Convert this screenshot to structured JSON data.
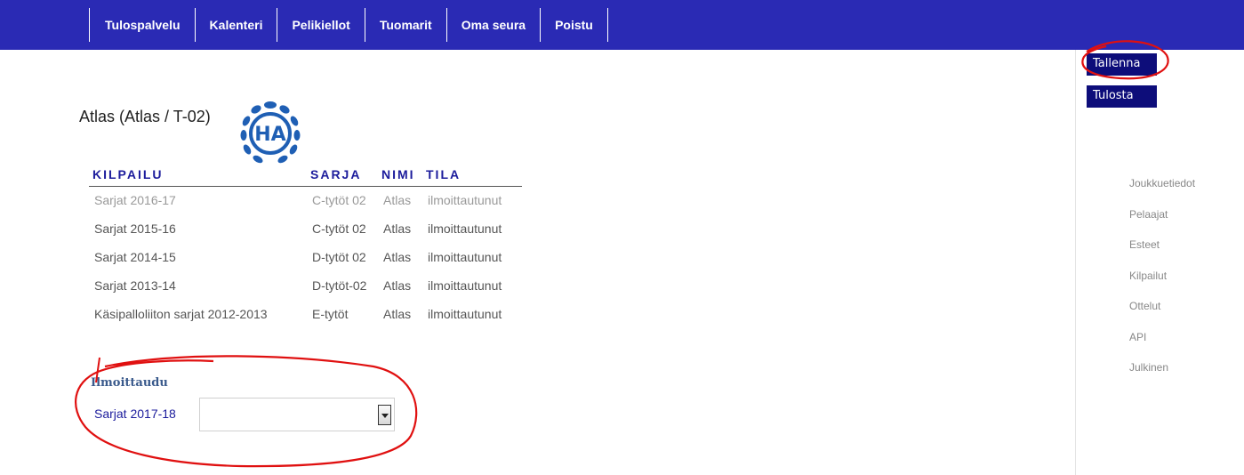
{
  "nav": {
    "items": [
      "Tulospalvelu",
      "Kalenteri",
      "Pelikiellot",
      "Tuomarit",
      "Oma seura",
      "Poistu"
    ]
  },
  "actions": {
    "save_label": "Tallenna",
    "print_label": "Tulosta"
  },
  "side_menu": [
    "Joukkuetiedot",
    "Pelaajat",
    "Esteet",
    "Kilpailut",
    "Ottelut",
    "API",
    "Julkinen"
  ],
  "page": {
    "title": "Atlas (Atlas / T-02)",
    "logo_text": "HA"
  },
  "table": {
    "headers": [
      "KILPAILU",
      "SARJA",
      "NIMI",
      "TILA"
    ],
    "rows": [
      [
        "Sarjat 2016-17",
        "C-tytöt 02",
        "Atlas",
        "ilmoittautunut"
      ],
      [
        "Sarjat 2015-16",
        "C-tytöt 02",
        "Atlas",
        "ilmoittautunut"
      ],
      [
        "Sarjat 2014-15",
        "D-tytöt 02",
        "Atlas",
        "ilmoittautunut"
      ],
      [
        "Sarjat 2013-14",
        "D-tytöt-02",
        "Atlas",
        "ilmoittautunut"
      ],
      [
        "Käsipalloliiton sarjat 2012-2013",
        "E-tytöt",
        "Atlas",
        "ilmoittautunut"
      ]
    ]
  },
  "register": {
    "title": "Ilmoittaudu",
    "label": "Sarjat 2017-18",
    "selected": ""
  },
  "colors": {
    "nav_bg": "#2a2ab4",
    "button_bg": "#0d0d7a",
    "header_text": "#1c1c9c",
    "annotation": "#e01010"
  }
}
